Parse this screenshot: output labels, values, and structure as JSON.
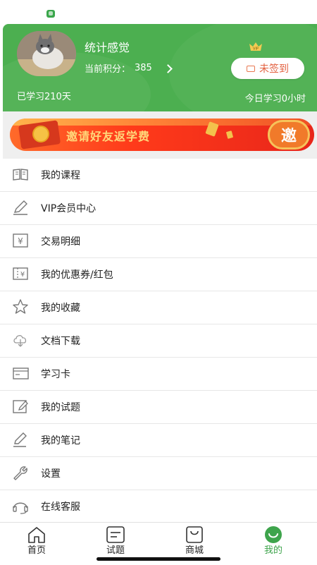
{
  "profile": {
    "username": "统计感觉",
    "points_label": "当前积分：",
    "points_value": "385",
    "checkin_label": "未签到",
    "studied_days": "已学习210天",
    "today_study": "今日学习0小时"
  },
  "banner": {
    "text": "邀请好友返学费",
    "invite_label": "邀"
  },
  "menu": {
    "items": [
      {
        "label": "我的课程",
        "icon": "book-icon"
      },
      {
        "label": "VIP会员中心",
        "icon": "pen-icon"
      },
      {
        "label": "交易明细",
        "icon": "yuan-receipt-icon"
      },
      {
        "label": "我的优惠券/红包",
        "icon": "coupon-icon"
      },
      {
        "label": "我的收藏",
        "icon": "star-icon"
      },
      {
        "label": "文档下载",
        "icon": "cloud-download-icon"
      },
      {
        "label": "学习卡",
        "icon": "card-icon"
      },
      {
        "label": "我的试题",
        "icon": "edit-icon"
      },
      {
        "label": "我的笔记",
        "icon": "pencil-icon"
      },
      {
        "label": "设置",
        "icon": "wrench-icon"
      },
      {
        "label": "在线客服",
        "icon": "headset-icon"
      }
    ]
  },
  "tabbar": {
    "tabs": [
      {
        "label": "首页",
        "icon": "home-icon"
      },
      {
        "label": "试题",
        "icon": "quiz-icon"
      },
      {
        "label": "商城",
        "icon": "shopping-bag-icon"
      },
      {
        "label": "我的",
        "icon": "profile-smile-icon"
      }
    ],
    "active_index": 3
  },
  "colors": {
    "header_green": "#4caf50",
    "active_tab": "#3ea44c",
    "banner_red": "#ff3a1a",
    "checkin_text": "#e25c3a"
  }
}
